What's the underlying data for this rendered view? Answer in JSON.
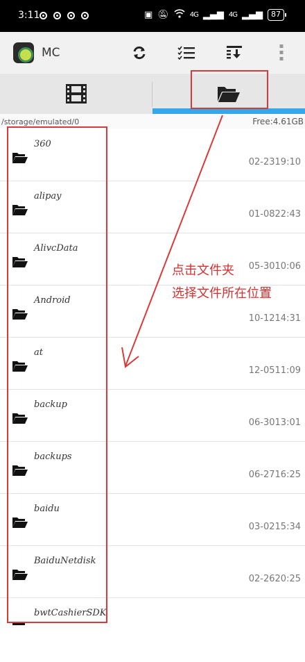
{
  "status_bar": {
    "time": "3:11",
    "network_labels": [
      "4G",
      "4G"
    ],
    "battery": "87"
  },
  "app_bar": {
    "title": "MC",
    "actions": [
      "refresh-icon",
      "checklist-icon",
      "download-list-icon",
      "more-vert-icon"
    ]
  },
  "tabs": [
    {
      "icon": "film-icon",
      "active": false
    },
    {
      "icon": "folder-open-icon",
      "active": true
    }
  ],
  "colors": {
    "tab_indicator": "#36a7e9",
    "annotation": "#d83a3a"
  },
  "path": "/storage/emulated/0",
  "free_space": "Free:4.61GB",
  "files": [
    {
      "name": "360",
      "date": "02-2319:10"
    },
    {
      "name": "alipay",
      "date": "01-0822:43"
    },
    {
      "name": "AlivcData",
      "date": "05-3010:06"
    },
    {
      "name": "Android",
      "date": "10-1214:31"
    },
    {
      "name": "at",
      "date": "12-0511:09"
    },
    {
      "name": "backup",
      "date": "06-3013:01"
    },
    {
      "name": "backups",
      "date": "06-2716:25"
    },
    {
      "name": "baidu",
      "date": "03-0215:34"
    },
    {
      "name": "BaiduNetdisk",
      "date": "02-2620:25"
    },
    {
      "name": "bwtCashierSDK",
      "date": ""
    }
  ],
  "annotation": {
    "line1": "点击文件夹",
    "line2": "选择文件所在位置"
  }
}
